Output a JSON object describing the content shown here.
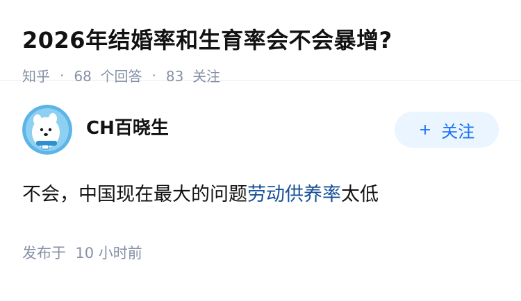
{
  "question": {
    "title": "2026年结婚率和生育率会不会暴增?",
    "source": "知乎",
    "separator": "·",
    "answers_count": "68",
    "answers_label": "个回答",
    "follows_count": "83",
    "follows_label": "关注"
  },
  "answer": {
    "author_name": "CH百晓生",
    "follow_button": {
      "icon": "+",
      "label": "关注"
    },
    "content_before": "不会，中国现在最大的问题",
    "content_link": "劳动供养率",
    "content_after": "太低",
    "published_label": "发布于",
    "published_time": "10 小时前"
  },
  "colors": {
    "accent": "#1772f6",
    "link": "#175199",
    "meta": "#8590a6"
  }
}
